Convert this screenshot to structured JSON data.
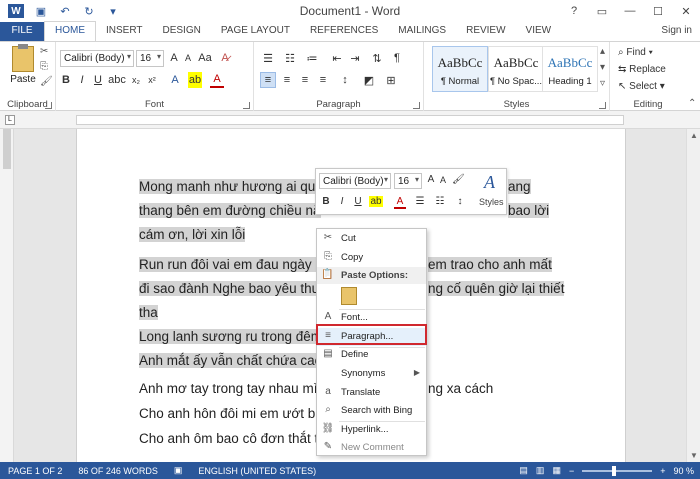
{
  "app": {
    "title": "Document1 - Word",
    "sign_in": "Sign in"
  },
  "tabs": [
    "FILE",
    "HOME",
    "INSERT",
    "DESIGN",
    "PAGE LAYOUT",
    "REFERENCES",
    "MAILINGS",
    "REVIEW",
    "VIEW"
  ],
  "ribbon": {
    "clipboard": {
      "paste": "Paste",
      "label": "Clipboard"
    },
    "font": {
      "family": "Calibri (Body)",
      "size": "16",
      "label": "Font"
    },
    "paragraph": {
      "label": "Paragraph"
    },
    "styles": {
      "label": "Styles",
      "items": [
        {
          "preview": "AaBbCc",
          "name": "¶ Normal"
        },
        {
          "preview": "AaBbCc",
          "name": "¶ No Spac..."
        },
        {
          "preview": "AaBbCc",
          "name": "Heading 1"
        }
      ]
    },
    "editing": {
      "find": "Find",
      "replace": "Replace",
      "select": "Select",
      "label": "Editing"
    }
  },
  "document": {
    "lines": [
      "Mong manh như hương ai qua",
      "thang bên em đường chiều nắ",
      "cám ơn, lời xin lỗi",
      "Run run đôi vai em đau ngày n",
      "đi sao đành Nghe bao yêu thư",
      "tha",
      "Long lanh sương ru trong đêm",
      "Anh mắt ấy vẫn chất chứa cao",
      "Anh mơ tay trong tay nhau mì",
      "Cho anh hôn đôi mi em ướt b",
      "Cho anh ôm bao cô đơn thắt t"
    ],
    "right_fragments": [
      "ang",
      "bao lời",
      "em trao cho anh mất",
      "ng cố quên giờ lại thiết",
      "ng xa cách"
    ]
  },
  "mini_toolbar": {
    "font": "Calibri (Body)",
    "size": "16",
    "styles_label": "Styles"
  },
  "context_menu": {
    "items": [
      {
        "icon": "✂",
        "label": "Cut"
      },
      {
        "icon": "⎘",
        "label": "Copy"
      }
    ],
    "paste_header": "Paste Options:",
    "items2": [
      {
        "icon": "A",
        "label": "Font..."
      },
      {
        "icon": "≡",
        "label": "Paragraph..."
      },
      {
        "icon": "▤",
        "label": "Define"
      },
      {
        "icon": "",
        "label": "Synonyms"
      },
      {
        "icon": "a",
        "label": "Translate"
      },
      {
        "icon": "⌕",
        "label": "Search with Bing"
      },
      {
        "icon": "⛓",
        "label": "Hyperlink..."
      },
      {
        "icon": "✎",
        "label": "New Comment"
      }
    ]
  },
  "status": {
    "page": "PAGE 1 OF 2",
    "words": "86 OF 246 WORDS",
    "language": "ENGLISH (UNITED STATES)",
    "zoom": "90 %"
  },
  "colors": {
    "accent": "#2b579a",
    "highlight_border": "#d0282e",
    "selection": "#d3d3d3"
  }
}
